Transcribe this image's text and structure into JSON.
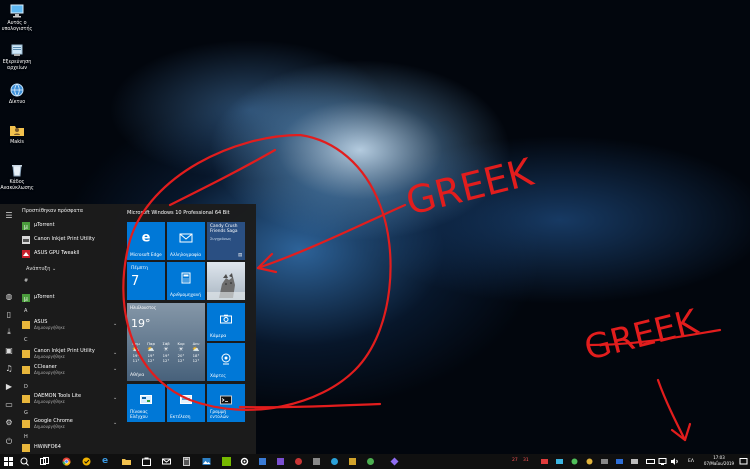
{
  "desktop": {
    "icons": [
      {
        "label": "Αυτός ο υπολογιστής",
        "icon": "this-pc-icon"
      },
      {
        "label": "Εξερεύνηση αρχείων",
        "icon": "file-explorer-icon"
      },
      {
        "label": "Δίκτυο",
        "icon": "network-icon"
      },
      {
        "label": "Makis",
        "icon": "user-folder-icon"
      },
      {
        "label": "Κάδος Ανακύκλωσης",
        "icon": "recycle-bin-icon"
      }
    ],
    "annotations": [
      "GREEK",
      "GREEK"
    ]
  },
  "start_menu": {
    "recently_added_title": "Προστέθηκαν πρόσφατα",
    "recent_apps": [
      {
        "name": "µTorrent",
        "sub": ""
      },
      {
        "name": "Canon Inkjet Print Utility",
        "sub": ""
      },
      {
        "name": "ASUS GPU Tweakll",
        "sub": ""
      }
    ],
    "expand_label": "Ανάπτυξη",
    "groups": [
      {
        "letter": "#",
        "apps": [
          {
            "name": "µTorrent",
            "sub": ""
          }
        ]
      },
      {
        "letter": "A",
        "apps": [
          {
            "name": "ASUS",
            "sub": "Δημιουργήθηκε"
          }
        ]
      },
      {
        "letter": "C",
        "apps": [
          {
            "name": "Canon Inkjet Print Utility",
            "sub": "Δημιουργήθηκε"
          },
          {
            "name": "CCleaner",
            "sub": "Δημιουργήθηκε"
          }
        ]
      },
      {
        "letter": "D",
        "apps": [
          {
            "name": "DAEMON Tools Lite",
            "sub": "Δημιουργήθηκε"
          }
        ]
      },
      {
        "letter": "G",
        "apps": [
          {
            "name": "Google Chrome",
            "sub": "Δημιουργήθηκε"
          }
        ]
      },
      {
        "letter": "H",
        "apps": [
          {
            "name": "HWiNFO64",
            "sub": ""
          }
        ]
      }
    ],
    "tile_group_title": "Microsoft Windows 10 Professional 64 Bit",
    "tiles": {
      "edge": "Microsoft Edge",
      "mail": "Αλληλογραφία",
      "candy": "Candy Crush Friends Saga",
      "candy_sub": "Συγχρόνως",
      "calendar_day": "Πέμπτη",
      "calendar_date": "7",
      "calculator": "Αριθμομηχανή",
      "weather_title": "Ηλιόλουστος",
      "weather_temp": "19°",
      "weather_city": "Αθήνα",
      "weather_days": [
        {
          "name": "Πεμ",
          "hi": "19°",
          "lo": "11°"
        },
        {
          "name": "Παρ",
          "hi": "19°",
          "lo": "12°"
        },
        {
          "name": "Σάβ",
          "hi": "19°",
          "lo": "12°"
        },
        {
          "name": "Κυρ",
          "hi": "20°",
          "lo": "12°"
        },
        {
          "name": "Δευ",
          "hi": "18°",
          "lo": "12°"
        }
      ],
      "camera": "Κάμερα",
      "maps": "Χάρτες",
      "control_panel": "Πίνακας Ελέγχου",
      "run": "Εκτέλεση",
      "cmd": "Γραμμή εντολών"
    }
  },
  "taskbar": {
    "time": "17:03",
    "date": "07/Μαΐου/2019",
    "language": "ΕΛ",
    "tray_numbers": [
      "27",
      "31"
    ]
  },
  "colors": {
    "accent": "#0078d7",
    "annotation": "#e21d1d",
    "menu_bg": "#1c1c1c"
  }
}
